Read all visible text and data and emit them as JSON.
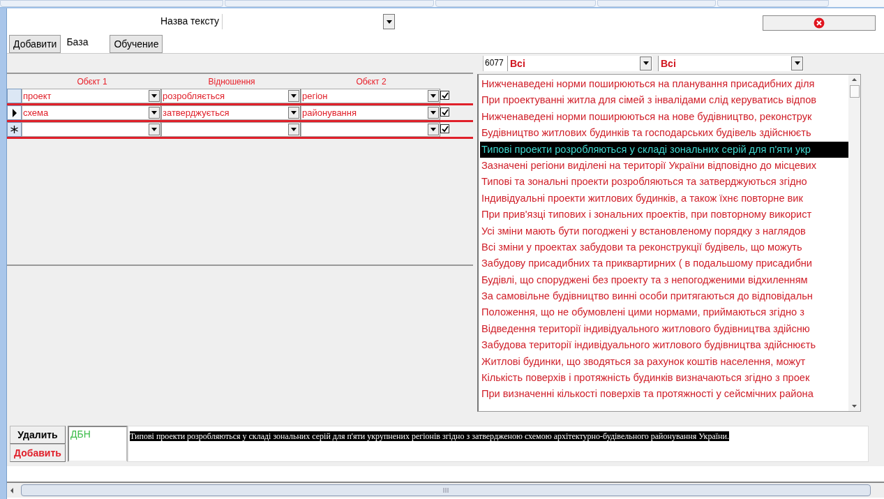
{
  "text_name": {
    "label": "Назва тексту"
  },
  "tabs": [
    {
      "label": "Добавити",
      "selected": false
    },
    {
      "label": "База",
      "selected": true
    },
    {
      "label": "Обучение",
      "selected": false
    }
  ],
  "filters": {
    "count": "6077",
    "filter_1": "Всі",
    "filter_2": "Всі"
  },
  "grid": {
    "columns": [
      "Обєкт 1",
      "Відношення",
      "Обєкт 2"
    ],
    "rows": [
      {
        "kind": "record",
        "selected": false,
        "cells": [
          "проект",
          "розробляється",
          "регіон"
        ],
        "checked": true
      },
      {
        "kind": "record",
        "selected": true,
        "cells": [
          "схема",
          "затверджується",
          "районування"
        ],
        "checked": true
      },
      {
        "kind": "new",
        "selected": false,
        "cells": [
          "",
          "",
          ""
        ],
        "checked": true
      }
    ]
  },
  "sentences": [
    {
      "text": "Нижченаведені норми поширюються на планування присадибних діля",
      "selected": false
    },
    {
      "text": "При проектуванні житла для сімей з інвалідами слід керуватись відпов",
      "selected": false
    },
    {
      "text": "Нижченаведені норми поширюються на нове будівництво, реконструк",
      "selected": false
    },
    {
      "text": "Будівництво житлових будинків та господарських будівель здійснюєть",
      "selected": false
    },
    {
      "text": "Типові проекти розробляються у складі зональних серій для п'яти укр",
      "selected": true
    },
    {
      "text": "Зазначені регіони виділені на території України відповідно до місцевих",
      "selected": false
    },
    {
      "text": "Типові та зональні проекти розробляються та затверджуються згідно",
      "selected": false
    },
    {
      "text": "Індивідуальні проекти житлових будинків, а також їхнє повторне вик",
      "selected": false
    },
    {
      "text": "При прив'язці типових і зональних проектів, при повторному використ",
      "selected": false
    },
    {
      "text": "Усі зміни мають бути погоджені у встановленому порядку з наглядов",
      "selected": false
    },
    {
      "text": "Всі зміни у проектах забудови та реконструкції будівель, що можуть",
      "selected": false
    },
    {
      "text": "Забудову присадибних та приквартирних ( в подальшому присадибни",
      "selected": false
    },
    {
      "text": "Будівлі, що споруджені без проекту та з непогодженими відхиленням",
      "selected": false
    },
    {
      "text": "За самовільне будівництво винні особи притягаються до відповідальн",
      "selected": false
    },
    {
      "text": "Положення, що не обумовлені цими нормами, приймаються згідно з",
      "selected": false
    },
    {
      "text": "Відведення території індивідуального житлового будівництва здійсню",
      "selected": false
    },
    {
      "text": "Забудова території індивідуального житлового будівництва здійснюєть",
      "selected": false
    },
    {
      "text": "Житлові будинки, що зводяться за рахунок коштів населення, можут",
      "selected": false
    },
    {
      "text": "Кількість поверхів і протяжність будинків визначаються згідно з проек",
      "selected": false
    },
    {
      "text": "При визначенні кількості поверхів та протяжності у сейсмічних района",
      "selected": false
    }
  ],
  "bottom": {
    "buttons": [
      {
        "kind": "delete",
        "label": "Удалить"
      },
      {
        "kind": "add",
        "label": "Добавить"
      }
    ],
    "source": "ДБН",
    "sentence": "Типові проекти розробляються у складі зональних серій для п'яти укрупнених регіонів згідно з затвердженою схемою архітектурно-будівельного районування України."
  }
}
